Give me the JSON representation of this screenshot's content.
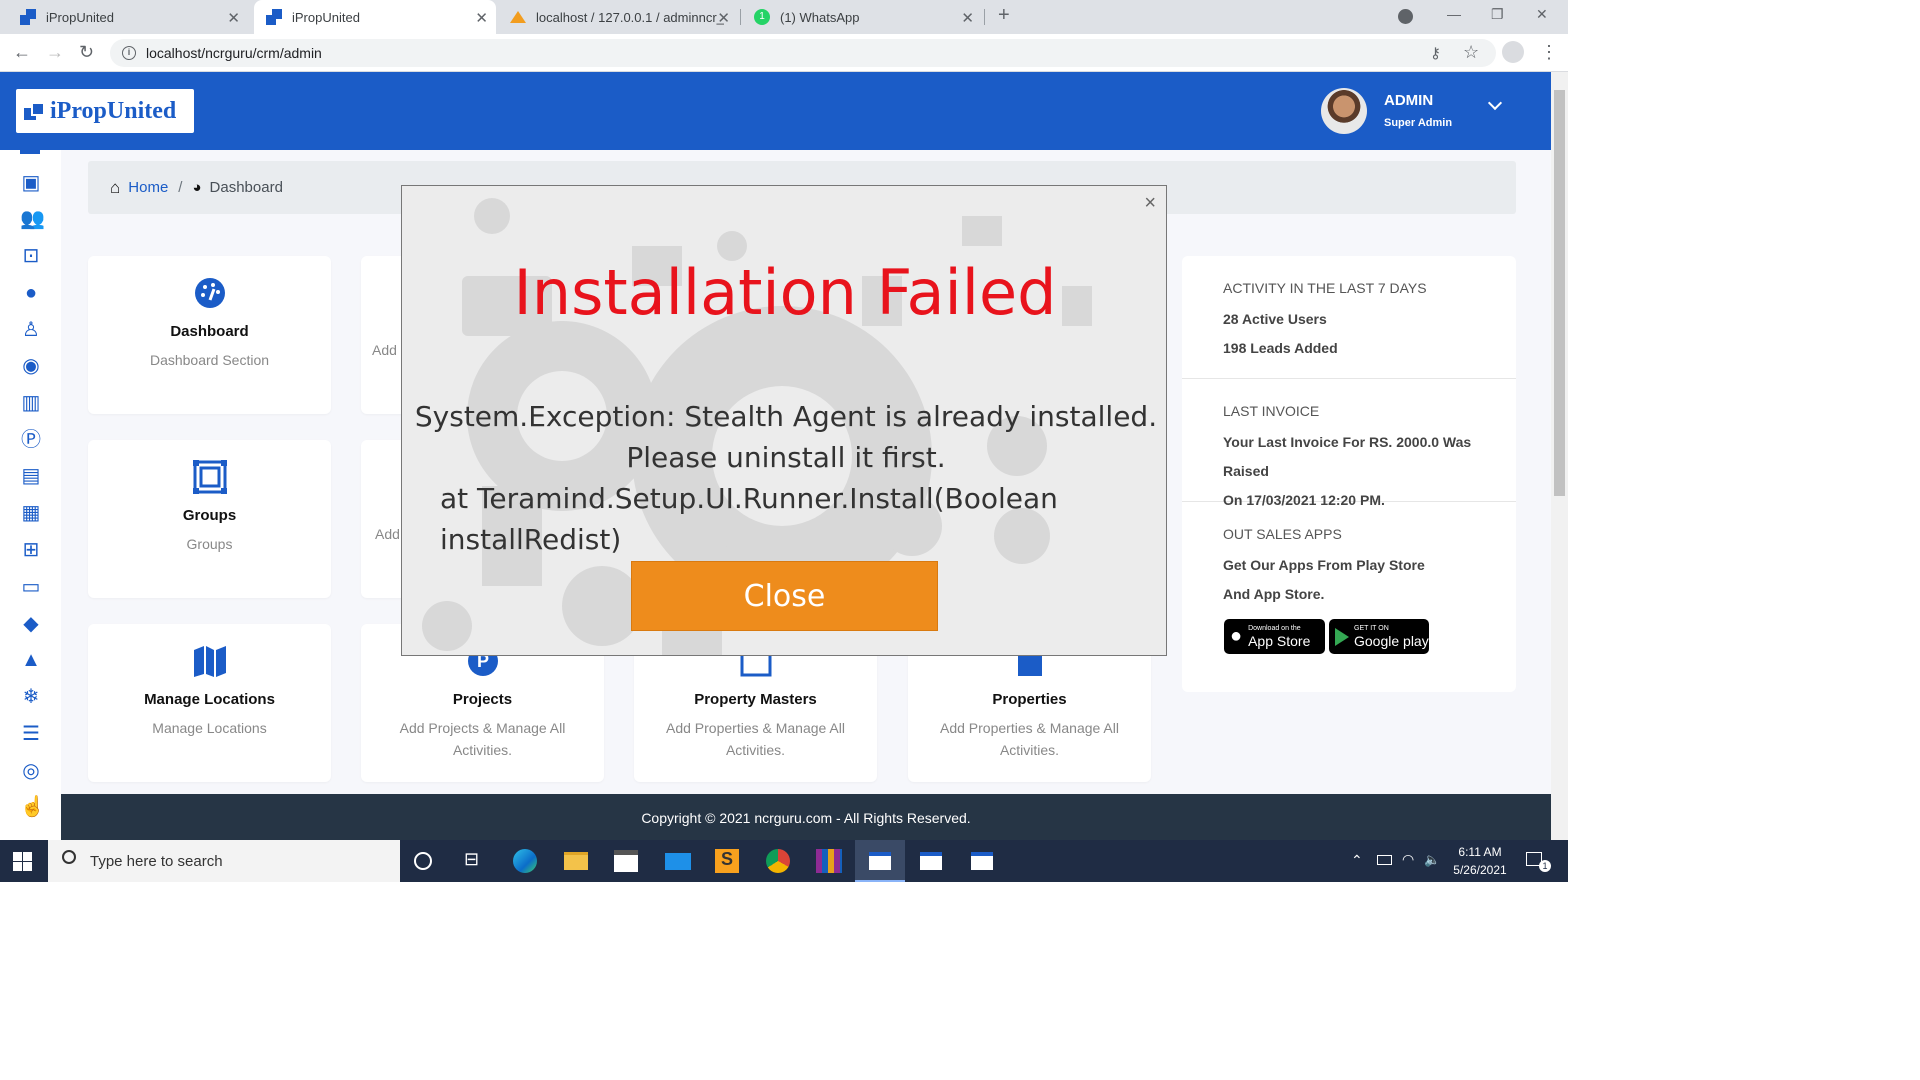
{
  "browser": {
    "tabs": [
      {
        "title": "iPropUnited",
        "active": false
      },
      {
        "title": "iPropUnited",
        "active": true
      },
      {
        "title": "localhost / 127.0.0.1 / adminncr_",
        "active": false
      },
      {
        "title": "(1) WhatsApp",
        "active": false
      }
    ],
    "url": "localhost/ncrguru/crm/admin"
  },
  "header": {
    "logo": "iPropUnited",
    "user_name": "ADMIN",
    "user_role": "Super Admin"
  },
  "breadcrumb": {
    "home": "Home",
    "separator": "/",
    "current": "Dashboard"
  },
  "cards": [
    {
      "title": "Dashboard",
      "subtitle": "Dashboard Section",
      "icon": "gauge-icon"
    },
    {
      "title": "",
      "subtitle": "Add",
      "icon": ""
    },
    {
      "title": "Groups",
      "subtitle": "Groups",
      "icon": "groups-icon"
    },
    {
      "title": "",
      "subtitle": "Add",
      "icon": ""
    },
    {
      "title": "Manage Locations",
      "subtitle": "Manage Locations",
      "icon": "map-icon"
    },
    {
      "title": "Projects",
      "subtitle": "Add Projects & Manage All Activities.",
      "icon": "parking-icon"
    },
    {
      "title": "Property Masters",
      "subtitle": "Add Properties & Manage All Activities.",
      "icon": "calendar-icon"
    },
    {
      "title": "Properties",
      "subtitle": "Add Properties & Manage All Activities.",
      "icon": "building-icon"
    }
  ],
  "activity": {
    "heading": "ACTIVITY IN THE LAST 7 DAYS",
    "active_users": "28 Active Users",
    "leads": "198 Leads Added"
  },
  "invoice": {
    "heading": "LAST INVOICE",
    "line1": "Your Last Invoice For RS. 2000.0 Was Raised",
    "line2": "On 17/03/2021 12:20 PM."
  },
  "apps": {
    "heading": "OUT SALES APPS",
    "line1": "Get Our Apps From Play Store",
    "line2": "And App Store.",
    "appstore_small": "Download on the",
    "appstore_big": "App Store",
    "play_small": "GET IT ON",
    "play_big": "Google play"
  },
  "footer": {
    "text": "Copyright © 2021 ncrguru.com - All Rights Reserved."
  },
  "modal": {
    "title": "Installation Failed",
    "message": "System.Exception: Stealth Agent is already installed. Please uninstall it first.",
    "trace": "at Teramind.Setup.UI.Runner.Install(Boolean installRedist)",
    "button": "Close",
    "close_glyph": "×"
  },
  "taskbar": {
    "search_placeholder": "Type here to search",
    "time": "6:11 AM",
    "date": "5/26/2021",
    "notification_count": "1"
  },
  "colors": {
    "brand": "#1b5cc7",
    "error": "#e8131c",
    "button": "#ee8c1c",
    "footer": "#263545"
  }
}
